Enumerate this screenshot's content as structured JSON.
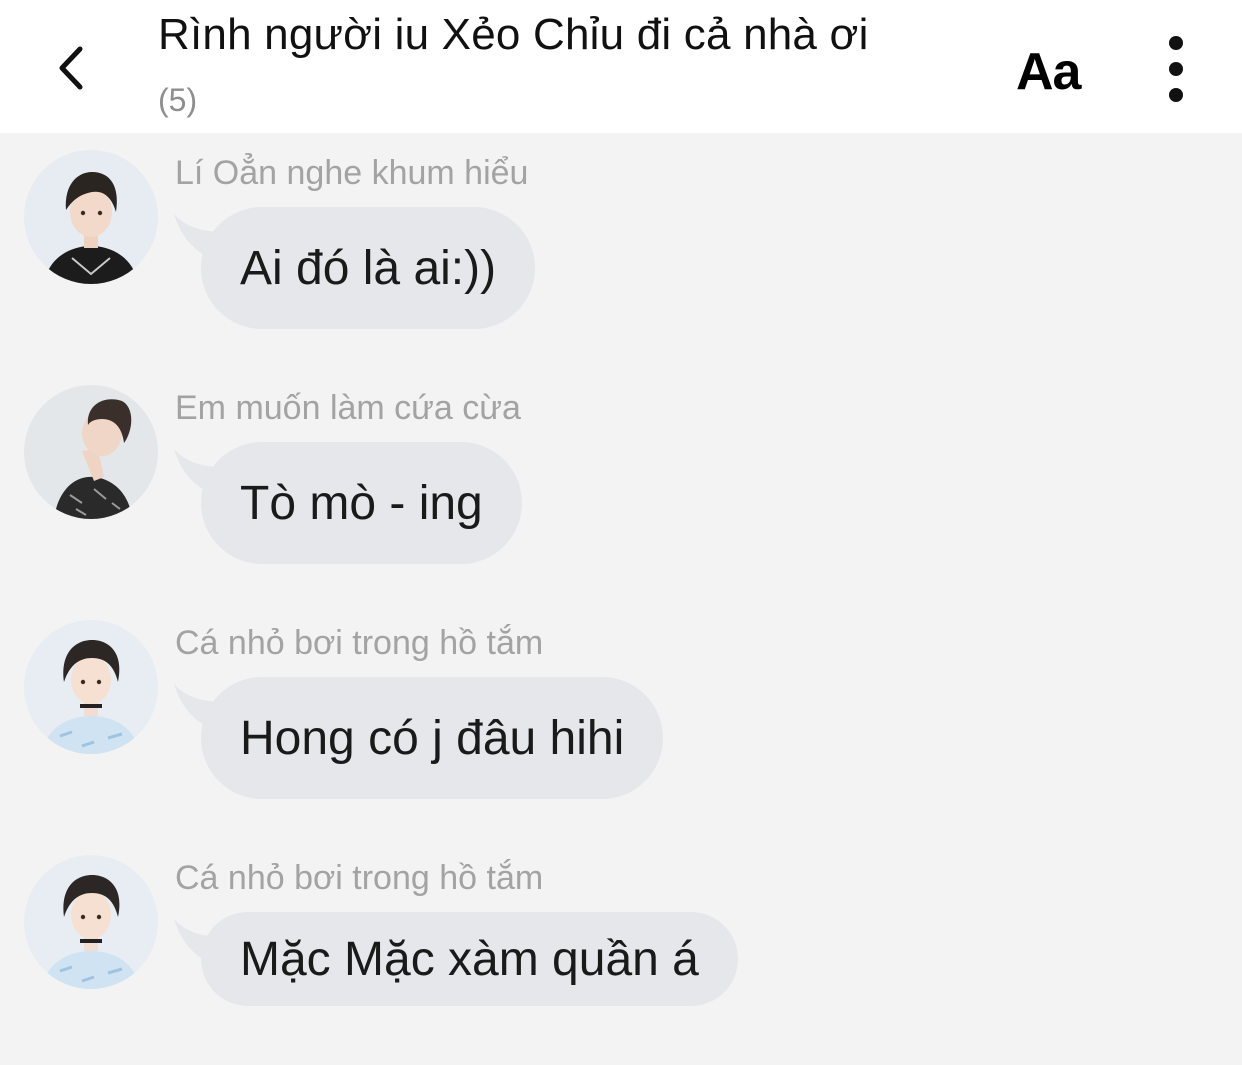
{
  "header": {
    "title": "Rình người iu Xẻo Chỉu đi cả nhà ơi",
    "member_count": "(5)",
    "font_button_label": "Aa",
    "back_icon": "chevron-left-icon",
    "more_icon": "more-vertical-icon"
  },
  "messages": [
    {
      "sender": "Lí Oẳn nghe khum hiểu",
      "text": "Ai đó là ai:))",
      "avatar": "avatar-black-shirt"
    },
    {
      "sender": "Em muốn làm cứa cừa",
      "text": "Tò mò - ing",
      "avatar": "avatar-profile-patterned-shirt"
    },
    {
      "sender": "Cá nhỏ bơi trong hồ tắm",
      "text": "Hong có j đâu hihi",
      "avatar": "avatar-light-blue-shirt"
    },
    {
      "sender": "Cá nhỏ bơi trong hồ tắm",
      "text": "Mặc Mặc xàm quần á",
      "avatar": "avatar-light-blue-shirt"
    }
  ],
  "colors": {
    "background": "#f3f3f3",
    "header": "#ffffff",
    "bubble": "#e5e7ea",
    "sender_text": "#a3a3a3"
  }
}
